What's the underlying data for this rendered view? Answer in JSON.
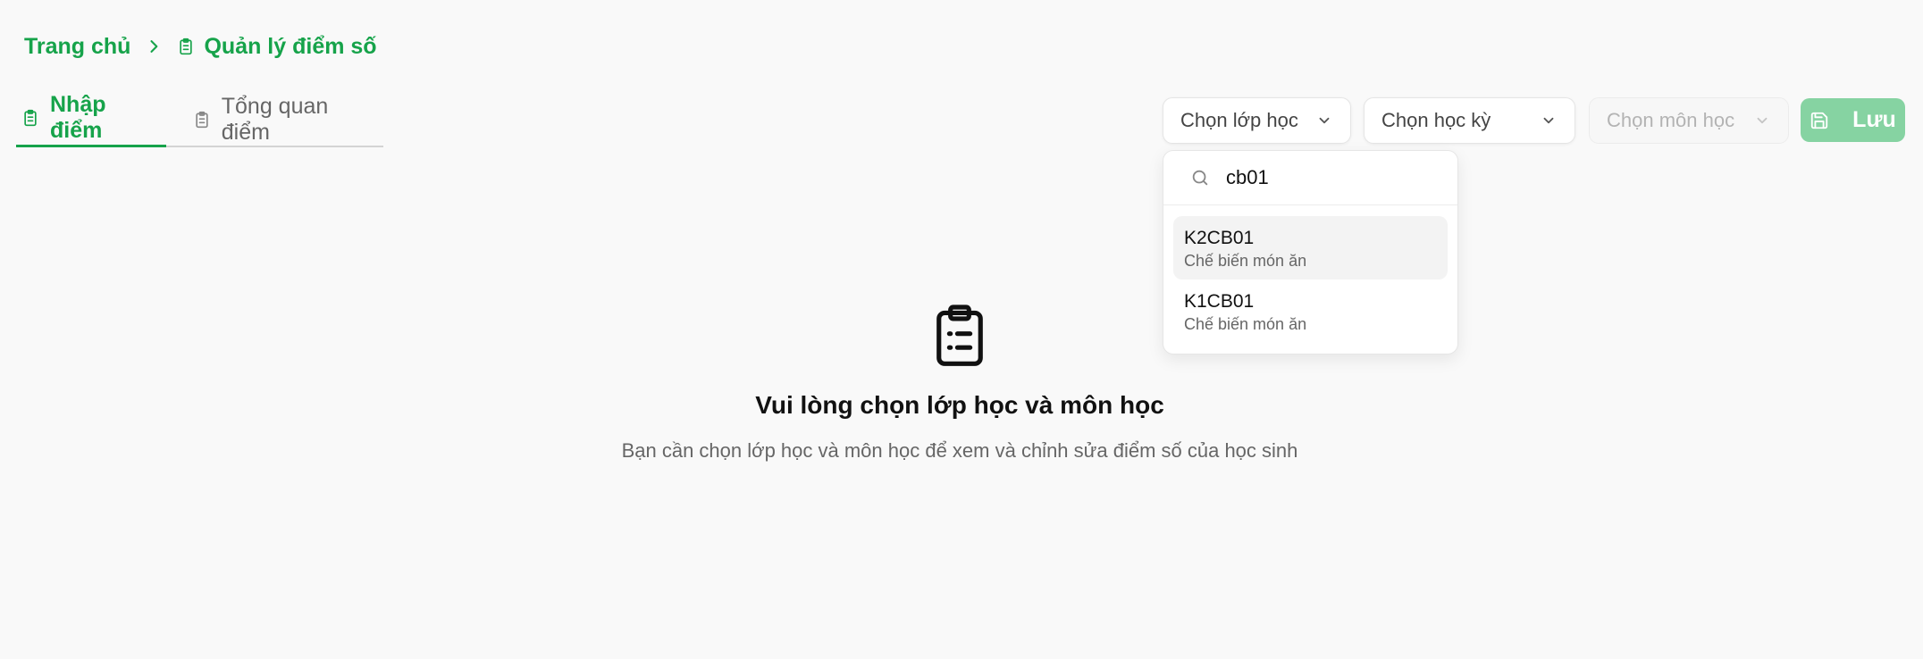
{
  "breadcrumb": {
    "home": "Trang chủ",
    "current": "Quản lý điểm số"
  },
  "tabs": [
    {
      "label": "Nhập điểm",
      "active": true
    },
    {
      "label": "Tổng quan điểm",
      "active": false
    }
  ],
  "toolbar": {
    "class_select": "Chọn lớp học",
    "semester_select": "Chọn học kỳ",
    "subject_select": "Chọn môn học",
    "save_label": "Lưu"
  },
  "dropdown": {
    "search_value": "cb01",
    "items": [
      {
        "code": "K2CB01",
        "desc": "Chế biến món ăn"
      },
      {
        "code": "K1CB01",
        "desc": "Chế biến món ăn"
      }
    ]
  },
  "empty_state": {
    "title": "Vui lòng chọn lớp học và môn học",
    "description": "Bạn cần chọn lớp học và môn học để xem và chỉnh sửa điểm số của học sinh"
  },
  "colors": {
    "accent": "#16a34a",
    "save_button": "#86d3a2",
    "background": "#f9f9f9"
  },
  "icons": [
    "chevron-right-icon",
    "clipboard-icon",
    "chevron-down-icon",
    "save-icon",
    "search-icon",
    "clipboard-list-icon"
  ]
}
